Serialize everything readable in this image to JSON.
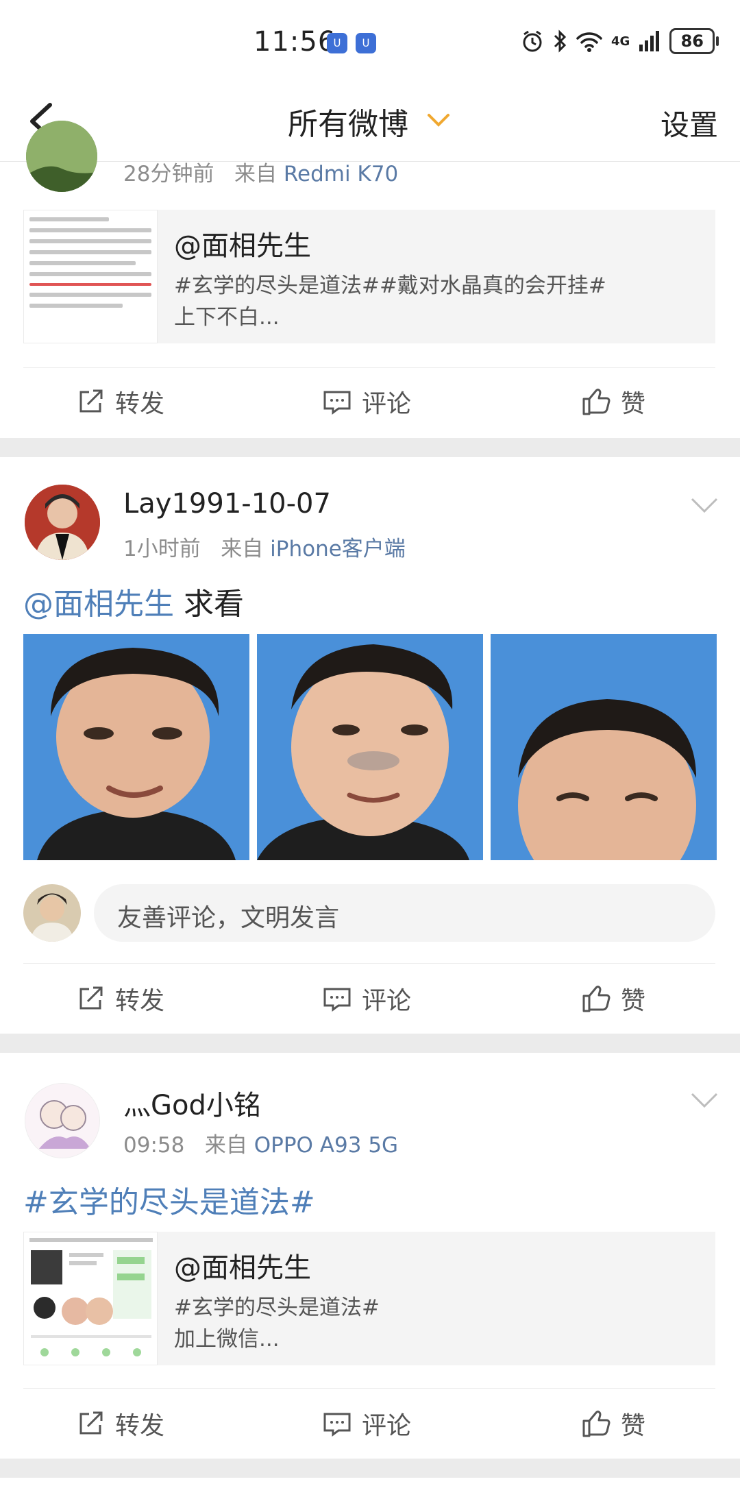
{
  "status": {
    "time": "11:56",
    "notif_icon": "ᑌ",
    "network": "4G",
    "battery": "86"
  },
  "nav": {
    "title": "所有微博",
    "settings": "设置"
  },
  "posts": [
    {
      "time": "28分钟前",
      "source_prefix": "来自",
      "source": "Redmi K70",
      "repost": {
        "author": "@面相先生",
        "text": "#玄学的尽头是道法##戴对水晶真的会开挂#\n上下不白..."
      }
    },
    {
      "username": "Lay1991-10-07",
      "time": "1小时前",
      "source_prefix": "来自",
      "source": "iPhone客户端",
      "mention": "@面相先生",
      "text": " 求看",
      "comment_placeholder": "友善评论，文明发言"
    },
    {
      "username": "灬God小铭",
      "time": "09:58",
      "source_prefix": "来自",
      "source": "OPPO A93 5G",
      "topic": "#玄学的尽头是道法#",
      "repost": {
        "author": "@面相先生",
        "text": "#玄学的尽头是道法#\n加上微信..."
      }
    }
  ],
  "actions": {
    "repost": "转发",
    "comment": "评论",
    "like": "赞"
  },
  "colors": {
    "link": "#4f7fb8",
    "accent": "#f0a830",
    "gap": "#ebebeb"
  }
}
